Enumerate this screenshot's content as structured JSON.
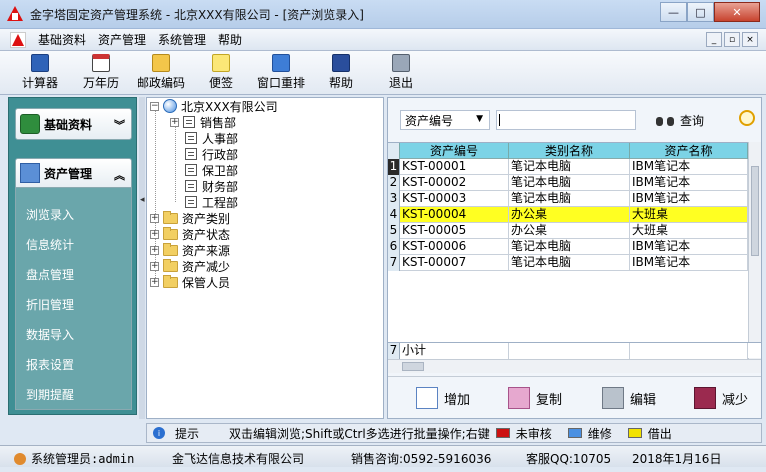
{
  "window": {
    "title": "金字塔固定资产管理系统 - 北京XXX有限公司 - [资产浏览录入]",
    "min_label": "—",
    "max_label": "□",
    "close_label": "✕"
  },
  "menubar": {
    "items": [
      "基础资料",
      "资产管理",
      "系统管理",
      "帮助"
    ],
    "mdi_min": "_",
    "mdi_restore": "▫",
    "mdi_close": "×"
  },
  "toolbar": {
    "items": [
      {
        "label": "计算器",
        "icon": "calculator-icon"
      },
      {
        "label": "万年历",
        "icon": "calendar-icon"
      },
      {
        "label": "邮政编码",
        "icon": "postcode-icon"
      },
      {
        "label": "便签",
        "icon": "note-icon"
      },
      {
        "label": "窗口重排",
        "icon": "windows-icon"
      },
      {
        "label": "帮助",
        "icon": "help-book-icon"
      },
      {
        "label": "退出",
        "icon": "exit-door-icon"
      }
    ]
  },
  "sidebar": {
    "group1": {
      "title": "基础资料",
      "chevron": "︾"
    },
    "group2": {
      "title": "资产管理",
      "chevron": "︽"
    },
    "items": [
      "浏览录入",
      "信息统计",
      "盘点管理",
      "折旧管理",
      "数据导入",
      "报表设置",
      "到期提醒"
    ]
  },
  "tree": {
    "root": "北京XXX有限公司",
    "departments": [
      "销售部",
      "人事部",
      "行政部",
      "保卫部",
      "财务部",
      "工程部"
    ],
    "categories": [
      "资产类别",
      "资产状态",
      "资产来源",
      "资产减少",
      "保管人员"
    ],
    "plus": "+",
    "minus": "−"
  },
  "search": {
    "field": "资产编号",
    "value": "",
    "button": "查询"
  },
  "grid": {
    "columns": [
      "资产编号",
      "类别名称",
      "资产名称"
    ],
    "rows": [
      {
        "n": "1",
        "code": "KST-00001",
        "category": "笔记本电脑",
        "name": "IBM笔记本"
      },
      {
        "n": "2",
        "code": "KST-00002",
        "category": "笔记本电脑",
        "name": "IBM笔记本"
      },
      {
        "n": "3",
        "code": "KST-00003",
        "category": "笔记本电脑",
        "name": "IBM笔记本"
      },
      {
        "n": "4",
        "code": "KST-00004",
        "category": "办公桌",
        "name": "大班桌"
      },
      {
        "n": "5",
        "code": "KST-00005",
        "category": "办公桌",
        "name": "大班桌"
      },
      {
        "n": "6",
        "code": "KST-00006",
        "category": "笔记本电脑",
        "name": "IBM笔记本"
      },
      {
        "n": "7",
        "code": "KST-00007",
        "category": "笔记本电脑",
        "name": "IBM笔记本"
      }
    ],
    "footer": {
      "n": "7",
      "label": "小计"
    }
  },
  "actions": [
    "增加",
    "复制",
    "编辑",
    "减少"
  ],
  "hint": {
    "label": "提示",
    "text": "双击编辑浏览;Shift或Ctrl多选进行批量操作;右键",
    "legend": [
      {
        "label": "未审核",
        "color": "#cc1111"
      },
      {
        "label": "维修",
        "color": "#4a90e2"
      },
      {
        "label": "借出",
        "color": "#f2e200"
      }
    ]
  },
  "status": {
    "user": "系统管理员:admin",
    "company": "金飞达信息技术有限公司",
    "phone": "销售咨询:0592-5916036",
    "qq": "客服QQ:10705",
    "date": "2018年1月16日"
  },
  "colors": {
    "highlight_row": "#ffff22",
    "header": "#7cd3e6",
    "sidebar": "#3f8f94"
  }
}
